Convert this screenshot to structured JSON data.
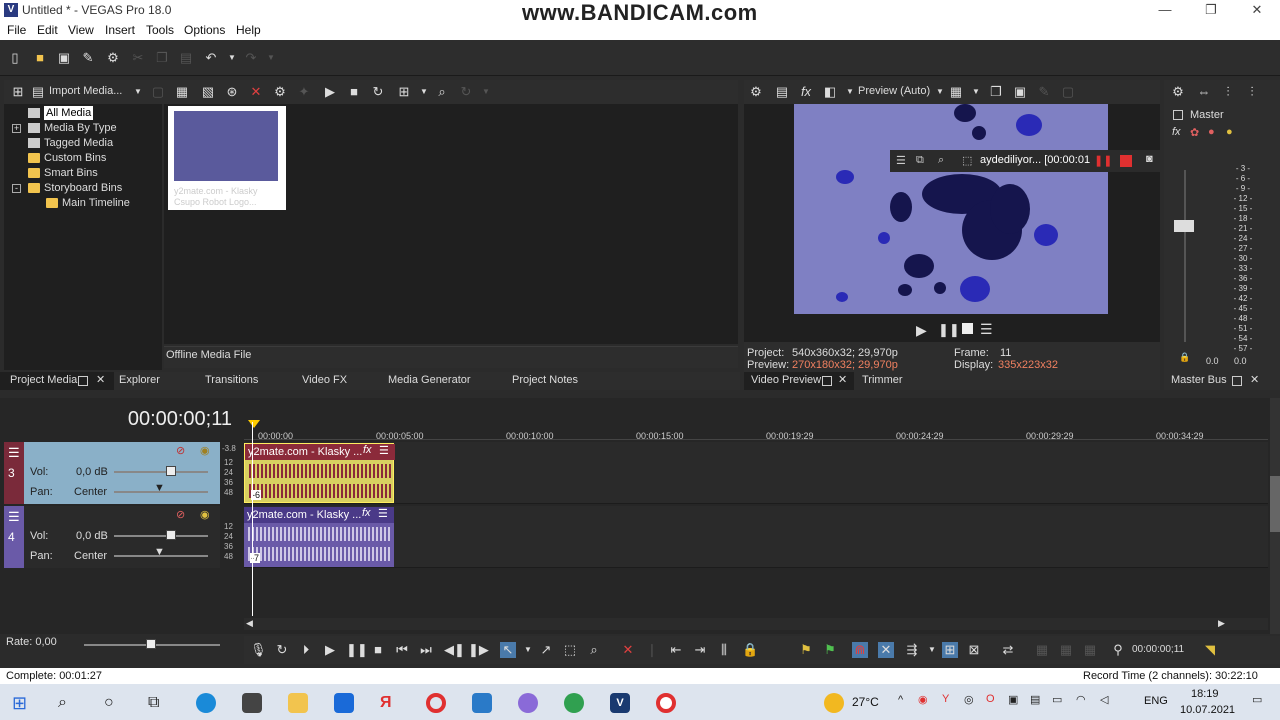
{
  "window": {
    "title": "Untitled * - VEGAS Pro 18.0",
    "watermark": "www.BANDICAM.com"
  },
  "menu": [
    "File",
    "Edit",
    "View",
    "Insert",
    "Tools",
    "Options",
    "Help"
  ],
  "project_media": {
    "import_label": "Import Media...",
    "tree": [
      {
        "label": "All Media",
        "selected": true,
        "indent": 0
      },
      {
        "label": "Media By Type",
        "indent": 0,
        "expand": "+"
      },
      {
        "label": "Tagged Media",
        "indent": 0
      },
      {
        "label": "Custom Bins",
        "indent": 0
      },
      {
        "label": "Smart Bins",
        "indent": 0
      },
      {
        "label": "Storyboard Bins",
        "indent": 0,
        "expand": "-"
      },
      {
        "label": "Main Timeline",
        "indent": 1
      }
    ],
    "thumbnail_caption": "y2mate.com - Klasky Csupo Robot Logo...",
    "offline_label": "Offline Media File"
  },
  "left_tabs": [
    "Project Media",
    "Explorer",
    "Transitions",
    "Video FX",
    "Media Generator",
    "Project Notes"
  ],
  "preview": {
    "mode": "Preview (Auto)",
    "recording_label": "aydediliyor... [00:00:01",
    "project_label": "Project:",
    "project_value": "540x360x32; 29,970p",
    "preview_label": "Preview:",
    "preview_value": "270x180x32; 29,970p",
    "frame_label": "Frame:",
    "frame_value": "11",
    "display_label": "Display:",
    "display_value": "335x223x32"
  },
  "mid_tabs": [
    "Video Preview",
    "Trimmer"
  ],
  "master": {
    "label": "Master",
    "scale": [
      "3",
      "6",
      "9",
      "12",
      "15",
      "18",
      "21",
      "24",
      "27",
      "30",
      "33",
      "36",
      "39",
      "42",
      "45",
      "48",
      "51",
      "54",
      "57"
    ],
    "left_value": "0.0",
    "right_value": "0.0",
    "tab": "Master Bus"
  },
  "timeline": {
    "time": "00:00:00;11",
    "ruler": [
      "00:00:00",
      "00:00:05:00",
      "00:00:10:00",
      "00:00:15:00",
      "00:00:19:29",
      "00:00:24:29",
      "00:00:29:29",
      "00:00:34:29"
    ],
    "marker_value": "-3.8",
    "tracks": [
      {
        "number": "3",
        "vol_label": "Vol:",
        "vol_value": "0,0 dB",
        "pan_label": "Pan:",
        "pan_value": "Center",
        "clip": "y2mate.com - Klasky ...",
        "clip_marker": "-6",
        "db_scale": [
          "12",
          "24",
          "36",
          "48"
        ]
      },
      {
        "number": "4",
        "vol_label": "Vol:",
        "vol_value": "0,0 dB",
        "pan_label": "Pan:",
        "pan_value": "Center",
        "clip": "y2mate.com - Klasky ...",
        "clip_marker": "-7",
        "db_scale": [
          "12",
          "24",
          "36",
          "48"
        ]
      }
    ],
    "rate": "Rate: 0,00",
    "cursor_time": "00:00:00;11"
  },
  "status": {
    "left": "Complete: 00:01:27",
    "right": "Record Time (2 channels): 30:22:10"
  },
  "taskbar": {
    "temp": "27°C",
    "lang": "ENG",
    "time": "18:19",
    "date": "10.07.2021"
  },
  "colors": {
    "track3": "#8ab0c8",
    "track3_clip": "#d8d060",
    "track4_clip": "#6a5aa8",
    "wave3": "#8b2a3a",
    "wave4": "#cfc8e6",
    "playhead": "#ffcc00"
  }
}
